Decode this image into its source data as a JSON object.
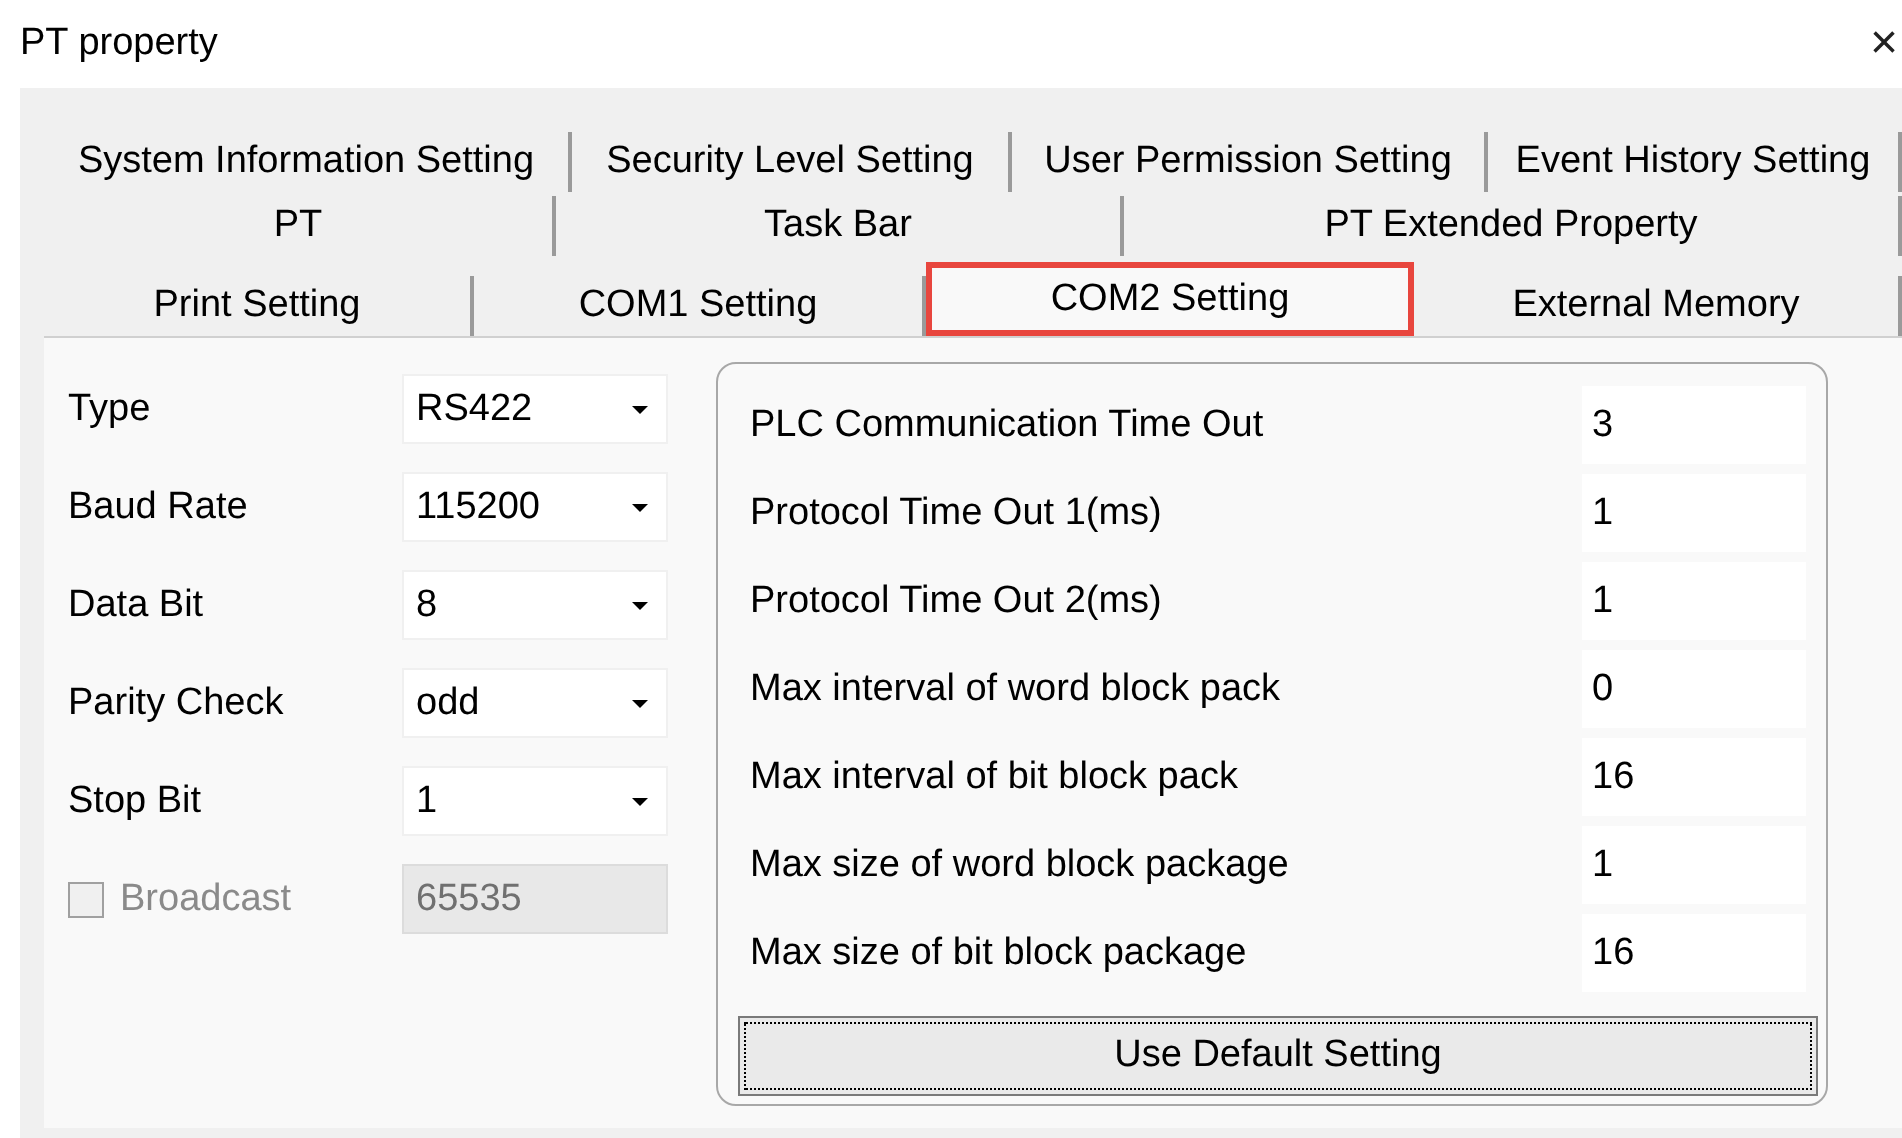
{
  "window": {
    "title": "PT property",
    "close": "×"
  },
  "tab_rows": [
    [
      {
        "label": "System Information Setting",
        "selected": false,
        "highlighted": false
      },
      {
        "label": "Security Level Setting",
        "selected": false,
        "highlighted": false
      },
      {
        "label": "User Permission Setting",
        "selected": false,
        "highlighted": false
      },
      {
        "label": "Event History Setting",
        "selected": false,
        "highlighted": false
      }
    ],
    [
      {
        "label": "PT",
        "selected": false,
        "highlighted": false
      },
      {
        "label": "Task Bar",
        "selected": false,
        "highlighted": false
      },
      {
        "label": "PT Extended Property",
        "selected": false,
        "highlighted": false
      }
    ],
    [
      {
        "label": "Print Setting",
        "selected": false,
        "highlighted": false
      },
      {
        "label": "COM1 Setting",
        "selected": false,
        "highlighted": false
      },
      {
        "label": "COM2 Setting",
        "selected": true,
        "highlighted": true
      },
      {
        "label": "External Memory",
        "selected": false,
        "highlighted": false
      }
    ]
  ],
  "serial": {
    "fields": [
      {
        "label": "Type",
        "value": "RS422"
      },
      {
        "label": "Baud Rate",
        "value": "115200"
      },
      {
        "label": "Data Bit",
        "value": "8"
      },
      {
        "label": "Parity Check",
        "value": "odd"
      },
      {
        "label": "Stop Bit",
        "value": "1"
      }
    ],
    "broadcast": {
      "label": "Broadcast",
      "checked": false,
      "disabled": true,
      "value": "65535"
    }
  },
  "timing": {
    "fields": [
      {
        "label": "PLC Communication Time Out",
        "value": "3"
      },
      {
        "label": "Protocol Time Out 1(ms)",
        "value": "1"
      },
      {
        "label": "Protocol Time Out 2(ms)",
        "value": "1"
      },
      {
        "label": "Max interval of word block pack",
        "value": "0"
      },
      {
        "label": "Max interval of bit block pack",
        "value": "16"
      },
      {
        "label": "Max size of word block package",
        "value": "1"
      },
      {
        "label": "Max size of bit block package",
        "value": "16"
      }
    ],
    "button": "Use Default Setting"
  }
}
